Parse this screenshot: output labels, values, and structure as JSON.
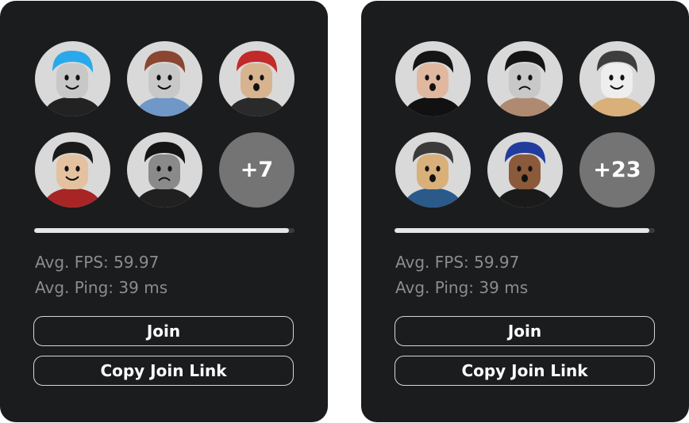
{
  "servers": [
    {
      "avatars": [
        {
          "icon": "avatar-icon",
          "hair": "#2aa9ea",
          "shirt": "#222222",
          "skin": "#c8c8c8",
          "face": "smile"
        },
        {
          "icon": "avatar-icon",
          "hair": "#8a4630",
          "shirt": "#6f97c7",
          "skin": "#c8c8c8",
          "face": "smile"
        },
        {
          "icon": "avatar-icon",
          "hair": "#c22a2a",
          "shirt": "#2a2a2a",
          "skin": "#d7b48f",
          "face": "shock"
        },
        {
          "icon": "avatar-icon",
          "hair": "#1a1a1a",
          "shirt": "#a82525",
          "skin": "#e4c2a0",
          "face": "smile"
        },
        {
          "icon": "avatar-icon",
          "hair": "#151515",
          "shirt": "#202020",
          "skin": "#8a8a8a",
          "face": "frown"
        }
      ],
      "more_label": "+7",
      "fill": 0.98,
      "fps_text": "Avg. FPS: 59.97",
      "ping_text": "Avg. Ping: 39 ms",
      "join_label": "Join",
      "copy_label": "Copy Join Link"
    },
    {
      "avatars": [
        {
          "icon": "avatar-icon",
          "hair": "#151515",
          "shirt": "#111111",
          "skin": "#e0b8a0",
          "face": "shock"
        },
        {
          "icon": "avatar-icon",
          "hair": "#151515",
          "shirt": "#b08a70",
          "skin": "#c8c8c8",
          "face": "frown"
        },
        {
          "icon": "avatar-icon",
          "hair": "#3d3d3d",
          "shirt": "#d9b07a",
          "skin": "#eeeeee",
          "face": "smile"
        },
        {
          "icon": "avatar-icon",
          "hair": "#3a3a3a",
          "shirt": "#2a5a8a",
          "skin": "#d9b07a",
          "face": "shock"
        },
        {
          "icon": "avatar-icon",
          "hair": "#223c9e",
          "shirt": "#1a1a1a",
          "skin": "#8a5a3a",
          "face": "shock"
        }
      ],
      "more_label": "+23",
      "fill": 0.98,
      "fps_text": "Avg. FPS: 59.97",
      "ping_text": "Avg. Ping: 39 ms",
      "join_label": "Join",
      "copy_label": "Copy Join Link"
    }
  ]
}
